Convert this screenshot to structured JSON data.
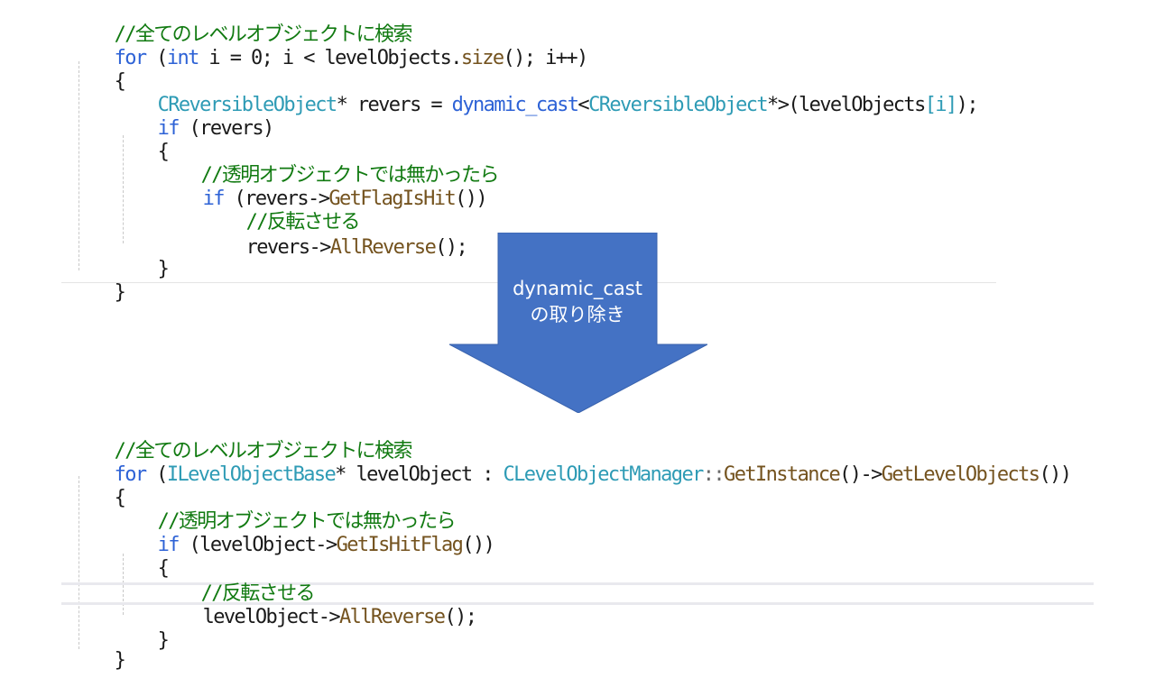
{
  "colors": {
    "keyword": "#2d62d6",
    "type": "#2e9bb5",
    "function": "#74531f",
    "comment": "#117a11",
    "text": "#1a1a1a",
    "arrow_fill": "#4472c4"
  },
  "top_code": {
    "comment_search": "//全てのレベルオブジェクトに検索",
    "for_kw": "for",
    "l2_a": " (",
    "int_kw": "int",
    "l2_b": " i = 0; i < levelObjects.",
    "size_fn": "size",
    "l2_c": "(); i++)",
    "brace_open": "{",
    "cls_a": "CReversibleObject",
    "l4_a": "* revers = ",
    "dyncast_kw": "dynamic_cast",
    "l4_b": "<",
    "cls_b": "CReversibleObject",
    "l4_c": "*>(levelObjects",
    "idx": "[i]",
    "l4_d": ");",
    "if_kw": "if",
    "l5_a": " (revers)",
    "inner_open": "{",
    "comment_transparent": "//透明オブジェクトでは無かったら",
    "if2_kw": "if",
    "l8_a": " (revers->",
    "getflag_fn": "GetFlagIsHit",
    "l8_b": "())",
    "comment_reverse": "//反転させる",
    "l10_a": "revers->",
    "allrev_fn": "AllReverse",
    "l10_b": "();",
    "inner_close": "}",
    "brace_close": "}"
  },
  "arrow": {
    "line1": "dynamic_cast",
    "line2": "の取り除き"
  },
  "bottom_code": {
    "comment_search": "//全てのレベルオブジェクトに検索",
    "for_kw": "for",
    "l2_a": " (",
    "ibase_type": "ILevelObjectBase",
    "l2_b": "* levelObject : ",
    "mgr_type": "CLevelObjectManager",
    "l2_c": "::",
    "getinst_fn": "GetInstance",
    "l2_d": "()->",
    "getlevel_fn": "GetLevelObjects",
    "l2_e": "())",
    "brace_open": "{",
    "comment_transparent": "//透明オブジェクトでは無かったら",
    "if_kw": "if",
    "l5_a": " (levelObject->",
    "getis_fn": "GetIsHitFlag",
    "l5_b": "())",
    "inner_open": "{",
    "comment_reverse": "//反転させる",
    "l8_a": "levelObject->",
    "allrev_fn": "AllReverse",
    "l8_b": "();",
    "inner_close": "}",
    "brace_close": "}"
  }
}
